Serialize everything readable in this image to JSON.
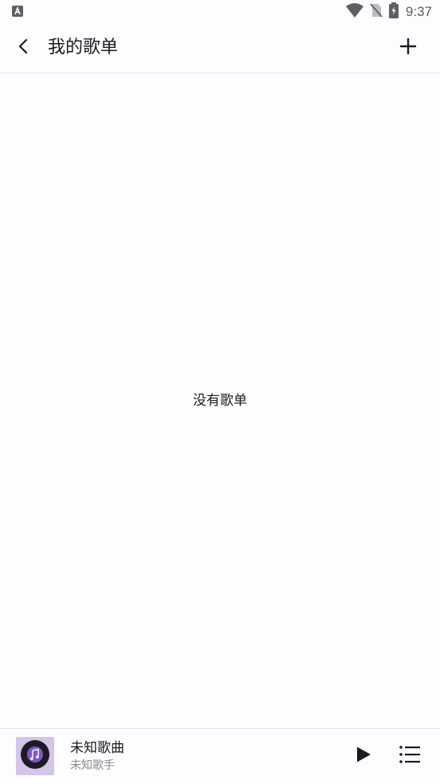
{
  "status_bar": {
    "time": "9:37",
    "icons": [
      "keyboard-a-icon",
      "wifi-icon",
      "no-sim-icon",
      "battery-charging-icon"
    ]
  },
  "app_bar": {
    "title": "我的歌单",
    "back_icon": "chevron-left-icon",
    "add_icon": "plus-icon"
  },
  "content": {
    "empty_message": "没有歌单"
  },
  "player": {
    "song_title": "未知歌曲",
    "artist": "未知歌手",
    "album_art_icon": "music-note-icon",
    "play_icon": "play-icon",
    "queue_icon": "playlist-icon"
  },
  "colors": {
    "background": "#fdfcff",
    "text_primary": "#1b1b1f",
    "text_secondary": "#8a8a8e",
    "divider": "#e4e3e8",
    "album_art_bg": "#d4c5ea",
    "album_disc": "#1e1c22",
    "album_accent": "#7f57c9"
  }
}
